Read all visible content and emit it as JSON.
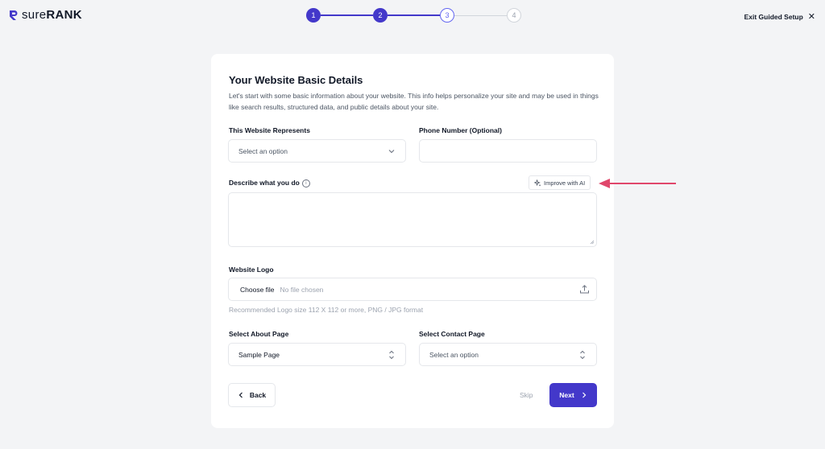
{
  "brand": {
    "name_light": "sure",
    "name_bold": "RANK",
    "accent_color": "#4338ca"
  },
  "stepper": {
    "steps": [
      "1",
      "2",
      "3",
      "4"
    ],
    "current": 3
  },
  "header": {
    "exit_label": "Exit Guided Setup"
  },
  "form": {
    "title": "Your Website Basic Details",
    "description": "Let's start with some basic information about your website. This info helps personalize your site and may be used in things like search results, structured data, and public details about your site.",
    "represents_label": "This Website Represents",
    "represents_value": "Select an option",
    "phone_label": "Phone Number (Optional)",
    "phone_value": "",
    "describe_label": "Describe what you do",
    "info_glyph": "i",
    "improve_ai_label": "Improve with AI",
    "describe_value": "",
    "logo_label": "Website Logo",
    "choose_file_label": "Choose file",
    "no_file_label": "No file chosen",
    "logo_hint": "Recommended Logo size 112 X 112 or more, PNG / JPG format",
    "about_label": "Select About Page",
    "about_value": "Sample Page",
    "contact_label": "Select Contact Page",
    "contact_value": "Select an option"
  },
  "actions": {
    "back_label": "Back",
    "skip_label": "Skip",
    "next_label": "Next"
  },
  "annotation": {
    "arrow_color": "#e0476b"
  }
}
